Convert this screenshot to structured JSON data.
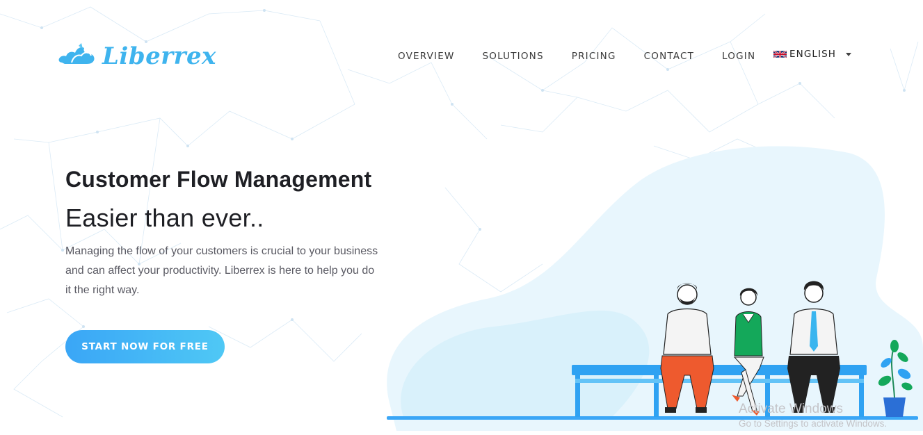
{
  "brand": {
    "name": "Liberrex",
    "color": "#3fb4ee"
  },
  "nav": {
    "items": [
      {
        "label": "OVERVIEW",
        "name": "nav-overview"
      },
      {
        "label": "SOLUTIONS",
        "name": "nav-solutions"
      },
      {
        "label": "PRICING",
        "name": "nav-pricing"
      },
      {
        "label": "CONTACT",
        "name": "nav-contact"
      },
      {
        "label": "LOGIN",
        "name": "nav-login"
      }
    ],
    "language": {
      "label": "ENGLISH",
      "flag_icon": "uk-flag-icon",
      "dropdown_icon": "caret-down-icon"
    }
  },
  "hero": {
    "title": "Customer Flow Management",
    "subtitle": "Easier than ever..",
    "description": "Managing the flow of your customers is crucial to your business and can affect your productivity. Liberrex is here to help you do it the right way.",
    "cta_label": "START NOW FOR FREE"
  },
  "illustration": {
    "icon": "people-waiting-on-bench-illustration",
    "accent": "#3aa6f6"
  },
  "watermark": {
    "title": "Activate Windows",
    "subtitle": "Go to Settings to activate Windows."
  }
}
